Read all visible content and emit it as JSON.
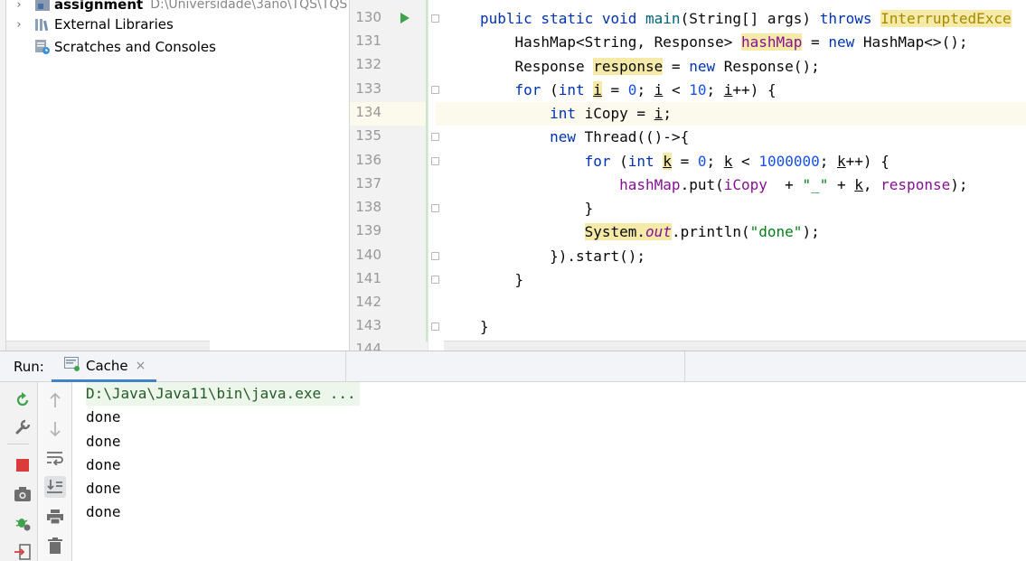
{
  "project_tree": {
    "items": [
      {
        "label": "assignment",
        "path": "D:\\Universidade\\3ano\\TQS\\TQS",
        "icon": "module-folder-icon"
      },
      {
        "label": "External Libraries",
        "icon": "libraries-icon"
      },
      {
        "label": "Scratches and Consoles",
        "icon": "scratches-icon"
      }
    ]
  },
  "editor": {
    "line_numbers": [
      "130",
      "131",
      "132",
      "133",
      "134",
      "135",
      "136",
      "137",
      "138",
      "139",
      "140",
      "141",
      "142",
      "143",
      "144"
    ],
    "current_line": "134"
  },
  "run_window": {
    "label": "Run:",
    "tab_title": "Cache",
    "close_glyph": "×",
    "console_lines": [
      "D:\\Java\\Java11\\bin\\java.exe ...",
      "done",
      "done",
      "done",
      "done",
      "done"
    ]
  },
  "colors": {
    "keyword": "#0033b3",
    "number": "#1750eb",
    "string": "#067d17",
    "field": "#871094",
    "tab_underline": "#4083c9",
    "change_bar": "#c9e6c9"
  }
}
